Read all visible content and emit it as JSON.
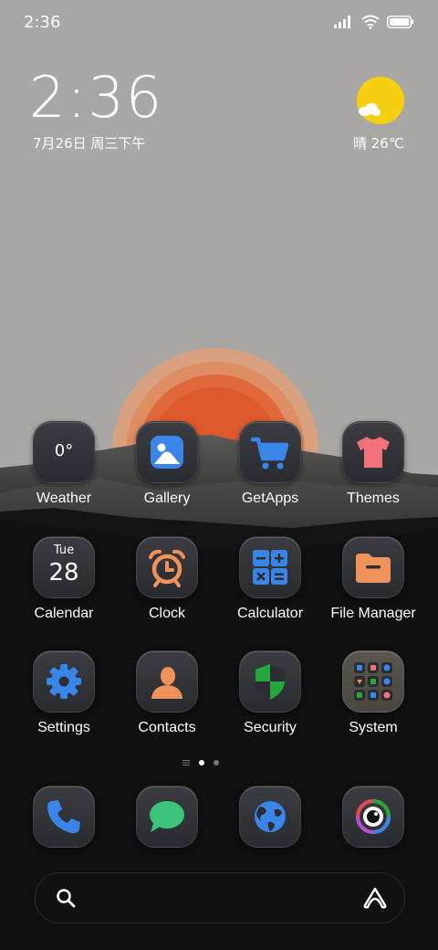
{
  "status_bar": {
    "time": "2:36"
  },
  "clock_widget": {
    "time": "2:36",
    "date": "7月26日 周三下午"
  },
  "weather_widget": {
    "condition_temp": "晴 26℃",
    "icon": "sun-cloud-icon"
  },
  "apps": [
    {
      "label": "Weather",
      "icon": "weather-icon",
      "tile_text": "0°"
    },
    {
      "label": "Gallery",
      "icon": "gallery-icon"
    },
    {
      "label": "GetApps",
      "icon": "cart-icon"
    },
    {
      "label": "Themes",
      "icon": "tshirt-icon"
    },
    {
      "label": "Calendar",
      "icon": "calendar-icon",
      "day": "Tue",
      "date": "28"
    },
    {
      "label": "Clock",
      "icon": "alarm-clock-icon"
    },
    {
      "label": "Calculator",
      "icon": "calculator-icon"
    },
    {
      "label": "File Manager",
      "icon": "folder-icon"
    },
    {
      "label": "Settings",
      "icon": "gear-icon"
    },
    {
      "label": "Contacts",
      "icon": "contact-icon"
    },
    {
      "label": "Security",
      "icon": "shield-icon"
    },
    {
      "label": "System",
      "icon": "folder-grid-icon"
    }
  ],
  "pages": {
    "current": 1,
    "total": 2
  },
  "dock": [
    {
      "name": "phone",
      "icon": "phone-icon"
    },
    {
      "name": "messages",
      "icon": "chat-bubble-icon"
    },
    {
      "name": "browser",
      "icon": "globe-icon"
    },
    {
      "name": "camera",
      "icon": "camera-lens-icon"
    }
  ],
  "search_bar": {
    "left_icon": "search-icon",
    "right_icon": "assistant-icon"
  },
  "colors": {
    "sky": "#a9a7a3",
    "sun": "#e05a2b",
    "blue": "#3a85e8",
    "orange": "#f0935a",
    "green": "#24a83d",
    "pink": "#f2707a",
    "yellow": "#f7cf11"
  }
}
